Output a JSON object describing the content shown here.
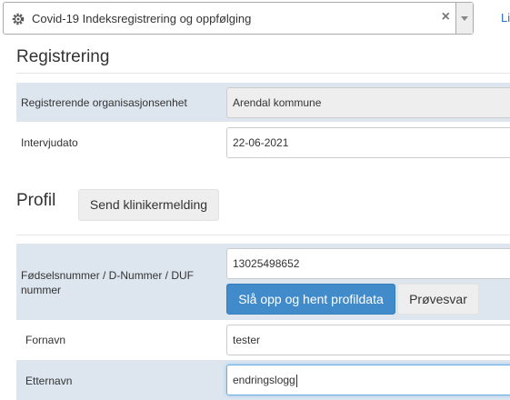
{
  "program": {
    "selected": "Covid-19 Indeksregistrering og oppfølging",
    "clear_glyph": "×",
    "icon": "gear-icon"
  },
  "top_link": "Li",
  "registrering": {
    "title": "Registrering",
    "fields": [
      {
        "label": "Registrerende organisasjonsenhet",
        "value": "Arendal kommune"
      },
      {
        "label": "Intervjudato",
        "value": "22-06-2021"
      }
    ]
  },
  "profil": {
    "title": "Profil",
    "send_button": "Send klinikermelding",
    "id_label": "Fødselsnummer / D-Nummer / DUF nummer",
    "id_value": "13025498652",
    "lookup_button": "Slå opp og hent profildata",
    "provesvar_button": "Prøvesvar",
    "fornavn_label": "Fornavn",
    "fornavn_value": "tester",
    "etternavn_label": "Etternavn",
    "etternavn_value": "endringslogg"
  },
  "colors": {
    "row_shade": "#dde6ef",
    "primary": "#428bca",
    "link": "#2a6fdb"
  }
}
